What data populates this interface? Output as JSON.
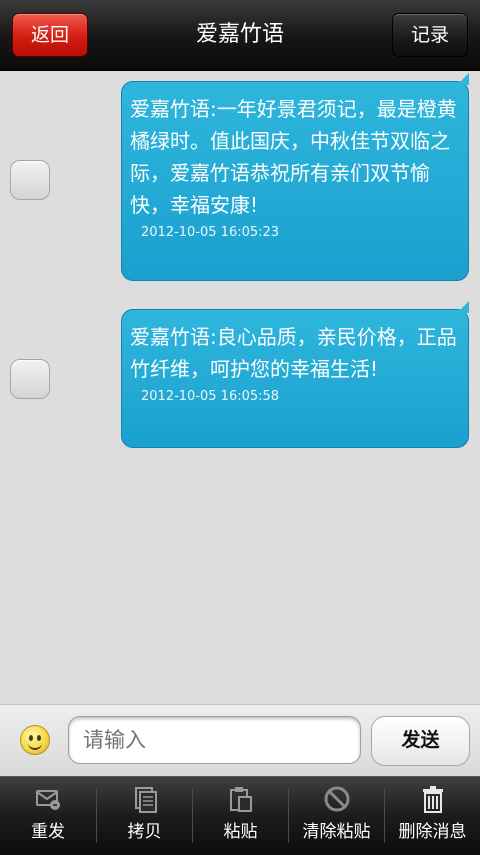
{
  "header": {
    "title": "爱嘉竹语",
    "back_label": "返回",
    "record_label": "记录"
  },
  "messages": [
    {
      "text": "爱嘉竹语:一年好景君须记，最是橙黄橘绿时。值此国庆，中秋佳节双临之际，爱嘉竹语恭祝所有亲们双节愉快，幸福安康!",
      "time": "2012-10-05 16:05:23"
    },
    {
      "text": "爱嘉竹语:良心品质，亲民价格，正品竹纤维，呵护您的幸福生活!",
      "time": "2012-10-05 16:05:58"
    }
  ],
  "input": {
    "placeholder": "请输入",
    "value": "",
    "send_label": "发送",
    "emoji_icon": "smiley-icon"
  },
  "toolbar": {
    "items": [
      {
        "label": "重发",
        "icon": "resend-icon"
      },
      {
        "label": "拷贝",
        "icon": "copy-icon"
      },
      {
        "label": "粘贴",
        "icon": "paste-icon"
      },
      {
        "label": "清除粘贴",
        "icon": "clear-paste-icon"
      },
      {
        "label": "删除消息",
        "icon": "trash-icon"
      }
    ]
  },
  "colors": {
    "bubble": "#1aa0cf",
    "back_button": "#d31d12"
  }
}
